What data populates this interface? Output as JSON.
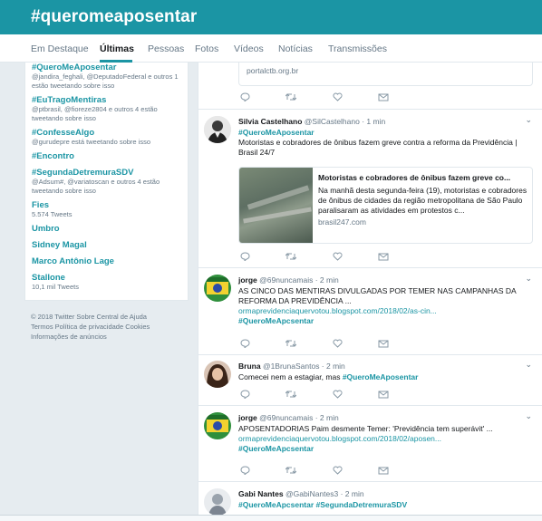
{
  "header": {
    "title": "#queromeaposentar"
  },
  "nav": {
    "tabs": [
      {
        "label": "Em Destaque",
        "active": false
      },
      {
        "label": "Últimas",
        "active": true
      },
      {
        "label": "Pessoas",
        "active": false
      },
      {
        "label": "Fotos",
        "active": false
      },
      {
        "label": "Vídeos",
        "active": false
      },
      {
        "label": "Notícias",
        "active": false
      },
      {
        "label": "Transmissões",
        "active": false
      }
    ]
  },
  "trends": [
    {
      "name": "#QueroMeAposentar",
      "desc": "@jandira_feghali, @DeputadoFederal e outros 1 estão tweetando sobre isso"
    },
    {
      "name": "#EuTragoMentiras",
      "desc": "@ptbrasil, @fioreze2804 e outros 4 estão tweetando sobre isso"
    },
    {
      "name": "#ConfesseAlgo",
      "desc": "@gurudepre está tweetando sobre isso"
    },
    {
      "name": "#Encontro",
      "desc": ""
    },
    {
      "name": "#SegundaDetremuraSDV",
      "desc": "@Adsum#, @variatoscan e outros 4 estão tweetando sobre isso"
    },
    {
      "name": "Fies",
      "desc": "5.574 Tweets"
    },
    {
      "name": "Umbro",
      "desc": ""
    },
    {
      "name": "Sidney Magal",
      "desc": ""
    },
    {
      "name": "Marco Antônio Lage",
      "desc": ""
    },
    {
      "name": "Stallone",
      "desc": "10,1 mil Tweets"
    }
  ],
  "footer": {
    "line1": "© 2018 Twitter   Sobre   Central de Ajuda",
    "line2": "Termos   Política de privacidade   Cookies",
    "line3": "Informações de anúncios"
  },
  "prev_card": {
    "url": "portalctb.org.br"
  },
  "tweets": [
    {
      "name": "Silvia Castelhano",
      "handle": "@SilCastelhano · 1 min",
      "hashtag_line": "#QueroMeAposentar",
      "text": "Motoristas e cobradores de ônibus fazem greve contra a reforma da Previdência | Brasil 24/7",
      "card": {
        "title": "Motoristas e cobradores de ônibus fazem greve co...",
        "desc": "Na manhã desta segunda-feira (19), motoristas e cobradores de ônibus de cidades da região metropolitana de São Paulo paralisaram as atividades em protestos c...",
        "url": "brasil247.com"
      }
    },
    {
      "name": "jorge",
      "handle": "@69nuncamais · 2 min",
      "text": "AS CINCO DAS MENTIRAS DIVULGADAS POR TEMER NAS CAMPANHAS DA REFORMA DA PREVIDÊNCIA ...",
      "link": "ormaprevidenciaquervotou.blogspot.com/2018/02/as-cin...",
      "hashtag": "#QueroMeApcsentar"
    },
    {
      "name": "Bruna",
      "handle": "@1BrunaSantos · 2 min",
      "text": "Comecei nem a estagiar, mas",
      "hashtag": "#QueroMeAposentar"
    },
    {
      "name": "jorge",
      "handle": "@69nuncamais · 2 min",
      "text": "APOSENTADORIAS Paim desmente Temer: 'Previdência tem superávit' ...",
      "link": "ormaprevidenciaquervotou.blogspot.com/2018/02/aposen...",
      "hashtag": "#QueroMeApcsentar"
    },
    {
      "name": "Gabi Nantes",
      "handle": "@GabiNantes3 · 2 min",
      "hashtag": "#QueroMeApcsentar #SegundaDetremuraSDV"
    }
  ],
  "icons": {
    "reply": "reply-icon",
    "retweet": "retweet-icon",
    "like": "heart-icon",
    "dm": "envelope-icon",
    "chevron": "chevron-down-icon"
  },
  "colors": {
    "accent": "#1b95a4",
    "muted": "#657786",
    "background": "#e6ecf0"
  }
}
